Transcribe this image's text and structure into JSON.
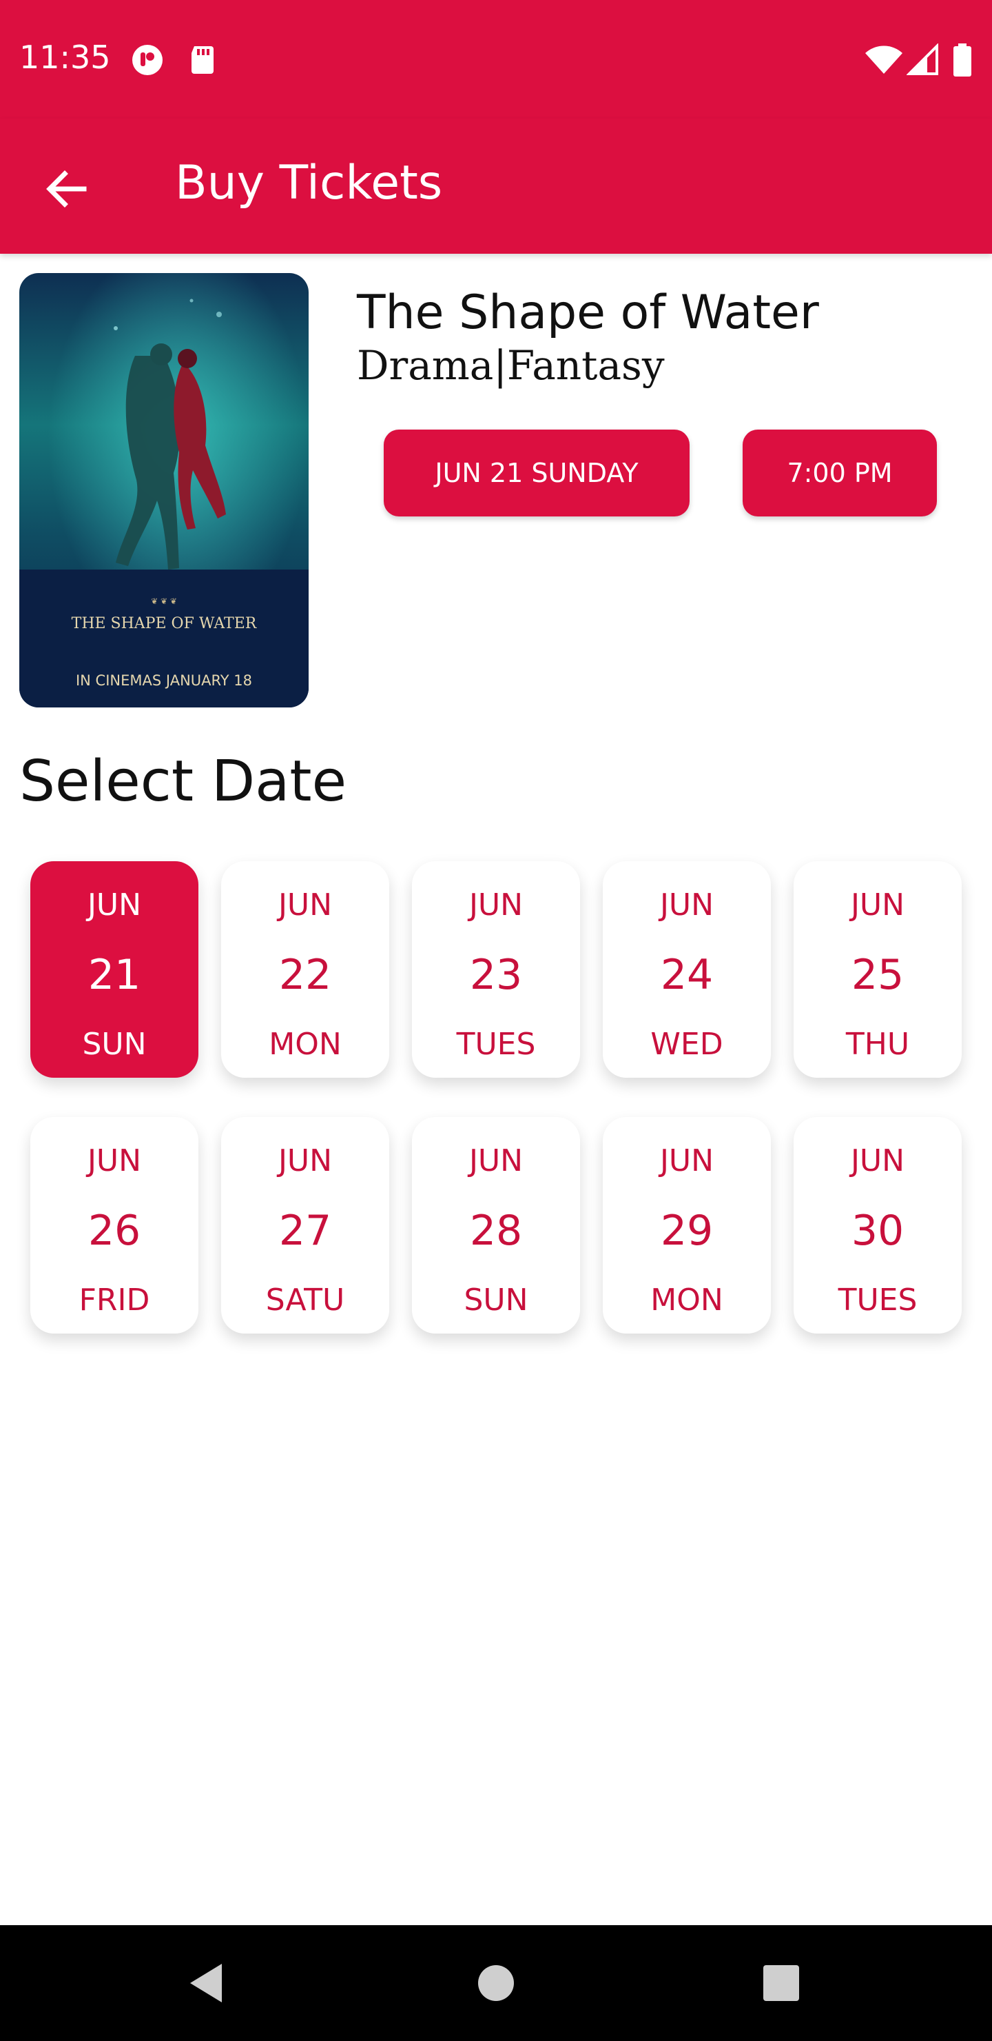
{
  "status_bar": {
    "time": "11:35",
    "icons": [
      "notification-badge-icon",
      "sd-card-icon",
      "wifi-icon",
      "cell-signal-icon",
      "battery-icon"
    ]
  },
  "app_bar": {
    "title": "Buy Tickets",
    "back_icon": "arrow-back-icon"
  },
  "movie": {
    "title": "The Shape of Water",
    "genre": "Drama|Fantasy",
    "poster": {
      "title_text": "THE SHAPE OF WATER",
      "tagline": "IN CINEMAS JANUARY 18"
    }
  },
  "selection": {
    "date_label": "JUN 21 SUNDAY",
    "time_label": "7:00 PM"
  },
  "select_date_heading": "Select Date",
  "dates": [
    {
      "month": "JUN",
      "day": "21",
      "weekday": "SUN",
      "selected": true
    },
    {
      "month": "JUN",
      "day": "22",
      "weekday": "MON",
      "selected": false
    },
    {
      "month": "JUN",
      "day": "23",
      "weekday": "TUES",
      "selected": false
    },
    {
      "month": "JUN",
      "day": "24",
      "weekday": "WED",
      "selected": false
    },
    {
      "month": "JUN",
      "day": "25",
      "weekday": "THU",
      "selected": false
    },
    {
      "month": "JUN",
      "day": "26",
      "weekday": "FRID",
      "selected": false
    },
    {
      "month": "JUN",
      "day": "27",
      "weekday": "SATU",
      "selected": false
    },
    {
      "month": "JUN",
      "day": "28",
      "weekday": "SUN",
      "selected": false
    },
    {
      "month": "JUN",
      "day": "29",
      "weekday": "MON",
      "selected": false
    },
    {
      "month": "JUN",
      "day": "30",
      "weekday": "TUES",
      "selected": false
    }
  ],
  "nav_bar": {
    "icons": [
      "nav-back-icon",
      "nav-home-icon",
      "nav-recents-icon"
    ]
  },
  "colors": {
    "accent": "#dc0f40",
    "accent_text": "#c8103c",
    "background": "#ffffff",
    "nav_bar": "#000000"
  }
}
